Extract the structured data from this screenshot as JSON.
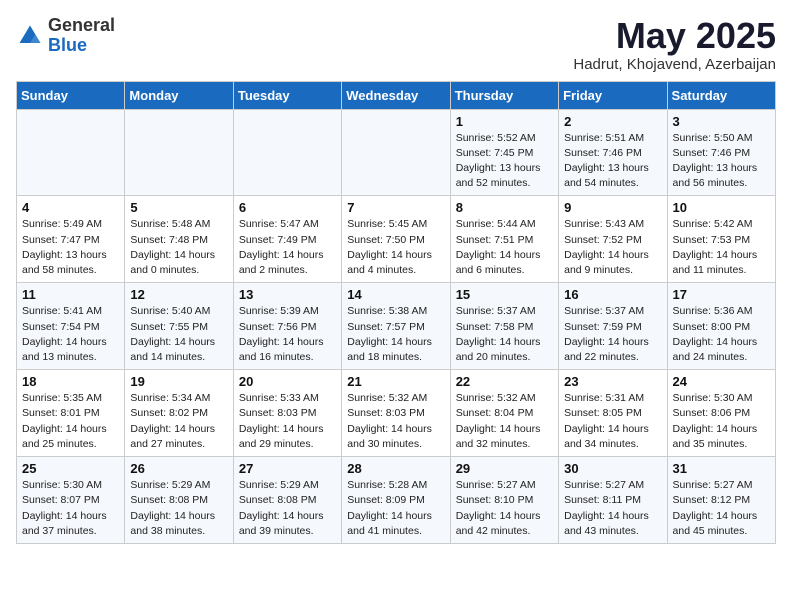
{
  "header": {
    "logo_general": "General",
    "logo_blue": "Blue",
    "month": "May 2025",
    "location": "Hadrut, Khojavend, Azerbaijan"
  },
  "weekdays": [
    "Sunday",
    "Monday",
    "Tuesday",
    "Wednesday",
    "Thursday",
    "Friday",
    "Saturday"
  ],
  "weeks": [
    [
      {
        "day": "",
        "info": ""
      },
      {
        "day": "",
        "info": ""
      },
      {
        "day": "",
        "info": ""
      },
      {
        "day": "",
        "info": ""
      },
      {
        "day": "1",
        "info": "Sunrise: 5:52 AM\nSunset: 7:45 PM\nDaylight: 13 hours\nand 52 minutes."
      },
      {
        "day": "2",
        "info": "Sunrise: 5:51 AM\nSunset: 7:46 PM\nDaylight: 13 hours\nand 54 minutes."
      },
      {
        "day": "3",
        "info": "Sunrise: 5:50 AM\nSunset: 7:46 PM\nDaylight: 13 hours\nand 56 minutes."
      }
    ],
    [
      {
        "day": "4",
        "info": "Sunrise: 5:49 AM\nSunset: 7:47 PM\nDaylight: 13 hours\nand 58 minutes."
      },
      {
        "day": "5",
        "info": "Sunrise: 5:48 AM\nSunset: 7:48 PM\nDaylight: 14 hours\nand 0 minutes."
      },
      {
        "day": "6",
        "info": "Sunrise: 5:47 AM\nSunset: 7:49 PM\nDaylight: 14 hours\nand 2 minutes."
      },
      {
        "day": "7",
        "info": "Sunrise: 5:45 AM\nSunset: 7:50 PM\nDaylight: 14 hours\nand 4 minutes."
      },
      {
        "day": "8",
        "info": "Sunrise: 5:44 AM\nSunset: 7:51 PM\nDaylight: 14 hours\nand 6 minutes."
      },
      {
        "day": "9",
        "info": "Sunrise: 5:43 AM\nSunset: 7:52 PM\nDaylight: 14 hours\nand 9 minutes."
      },
      {
        "day": "10",
        "info": "Sunrise: 5:42 AM\nSunset: 7:53 PM\nDaylight: 14 hours\nand 11 minutes."
      }
    ],
    [
      {
        "day": "11",
        "info": "Sunrise: 5:41 AM\nSunset: 7:54 PM\nDaylight: 14 hours\nand 13 minutes."
      },
      {
        "day": "12",
        "info": "Sunrise: 5:40 AM\nSunset: 7:55 PM\nDaylight: 14 hours\nand 14 minutes."
      },
      {
        "day": "13",
        "info": "Sunrise: 5:39 AM\nSunset: 7:56 PM\nDaylight: 14 hours\nand 16 minutes."
      },
      {
        "day": "14",
        "info": "Sunrise: 5:38 AM\nSunset: 7:57 PM\nDaylight: 14 hours\nand 18 minutes."
      },
      {
        "day": "15",
        "info": "Sunrise: 5:37 AM\nSunset: 7:58 PM\nDaylight: 14 hours\nand 20 minutes."
      },
      {
        "day": "16",
        "info": "Sunrise: 5:37 AM\nSunset: 7:59 PM\nDaylight: 14 hours\nand 22 minutes."
      },
      {
        "day": "17",
        "info": "Sunrise: 5:36 AM\nSunset: 8:00 PM\nDaylight: 14 hours\nand 24 minutes."
      }
    ],
    [
      {
        "day": "18",
        "info": "Sunrise: 5:35 AM\nSunset: 8:01 PM\nDaylight: 14 hours\nand 25 minutes."
      },
      {
        "day": "19",
        "info": "Sunrise: 5:34 AM\nSunset: 8:02 PM\nDaylight: 14 hours\nand 27 minutes."
      },
      {
        "day": "20",
        "info": "Sunrise: 5:33 AM\nSunset: 8:03 PM\nDaylight: 14 hours\nand 29 minutes."
      },
      {
        "day": "21",
        "info": "Sunrise: 5:32 AM\nSunset: 8:03 PM\nDaylight: 14 hours\nand 30 minutes."
      },
      {
        "day": "22",
        "info": "Sunrise: 5:32 AM\nSunset: 8:04 PM\nDaylight: 14 hours\nand 32 minutes."
      },
      {
        "day": "23",
        "info": "Sunrise: 5:31 AM\nSunset: 8:05 PM\nDaylight: 14 hours\nand 34 minutes."
      },
      {
        "day": "24",
        "info": "Sunrise: 5:30 AM\nSunset: 8:06 PM\nDaylight: 14 hours\nand 35 minutes."
      }
    ],
    [
      {
        "day": "25",
        "info": "Sunrise: 5:30 AM\nSunset: 8:07 PM\nDaylight: 14 hours\nand 37 minutes."
      },
      {
        "day": "26",
        "info": "Sunrise: 5:29 AM\nSunset: 8:08 PM\nDaylight: 14 hours\nand 38 minutes."
      },
      {
        "day": "27",
        "info": "Sunrise: 5:29 AM\nSunset: 8:08 PM\nDaylight: 14 hours\nand 39 minutes."
      },
      {
        "day": "28",
        "info": "Sunrise: 5:28 AM\nSunset: 8:09 PM\nDaylight: 14 hours\nand 41 minutes."
      },
      {
        "day": "29",
        "info": "Sunrise: 5:27 AM\nSunset: 8:10 PM\nDaylight: 14 hours\nand 42 minutes."
      },
      {
        "day": "30",
        "info": "Sunrise: 5:27 AM\nSunset: 8:11 PM\nDaylight: 14 hours\nand 43 minutes."
      },
      {
        "day": "31",
        "info": "Sunrise: 5:27 AM\nSunset: 8:12 PM\nDaylight: 14 hours\nand 45 minutes."
      }
    ]
  ]
}
